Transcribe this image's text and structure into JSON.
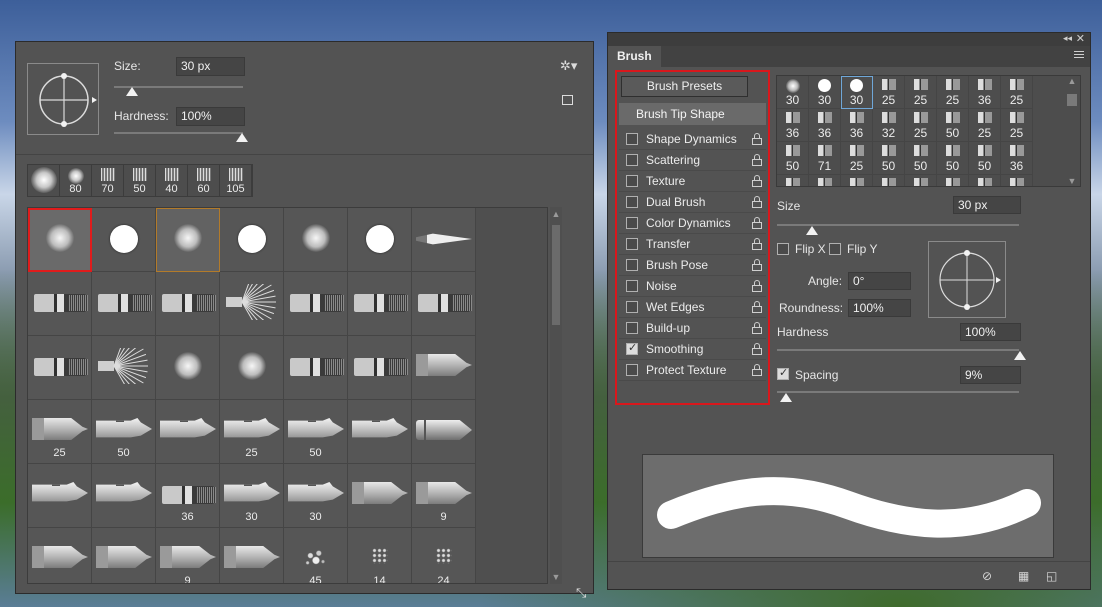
{
  "left_panel": {
    "size_label": "Size:",
    "size_value": "30 px",
    "hardness_label": "Hardness:",
    "hardness_value": "100%",
    "size_slider_fraction": 0.0,
    "hardness_slider_fraction": 1.0,
    "settings_icon": "gear-icon",
    "new_preset_icon": "new-preset-icon",
    "recent_brushes": [
      {
        "type": "soft-large",
        "label": ""
      },
      {
        "type": "soft",
        "label": "80"
      },
      {
        "type": "bristle",
        "label": "70"
      },
      {
        "type": "bristle",
        "label": "50"
      },
      {
        "type": "bristle",
        "label": "40"
      },
      {
        "type": "bristle",
        "label": "60"
      },
      {
        "type": "bristle",
        "label": "105"
      }
    ],
    "grid": [
      {
        "type": "soft",
        "label": "",
        "state": "red"
      },
      {
        "type": "hard",
        "label": ""
      },
      {
        "type": "soft",
        "label": "",
        "state": "orange"
      },
      {
        "type": "hard",
        "label": ""
      },
      {
        "type": "soft",
        "label": ""
      },
      {
        "type": "hard",
        "label": ""
      },
      {
        "type": "feather",
        "label": ""
      },
      {
        "type": "flat",
        "label": ""
      },
      {
        "type": "flat",
        "label": ""
      },
      {
        "type": "flat",
        "label": ""
      },
      {
        "type": "fan",
        "label": ""
      },
      {
        "type": "flat",
        "label": ""
      },
      {
        "type": "flat",
        "label": ""
      },
      {
        "type": "flat",
        "label": ""
      },
      {
        "type": "flat",
        "label": ""
      },
      {
        "type": "fan",
        "label": ""
      },
      {
        "type": "soft",
        "label": ""
      },
      {
        "type": "soft",
        "label": ""
      },
      {
        "type": "flat",
        "label": ""
      },
      {
        "type": "flat",
        "label": ""
      },
      {
        "type": "pencil",
        "label": ""
      },
      {
        "type": "pencil",
        "label": "25"
      },
      {
        "type": "calli",
        "label": "50"
      },
      {
        "type": "calli",
        "label": ""
      },
      {
        "type": "calli",
        "label": "25"
      },
      {
        "type": "calli",
        "label": "50"
      },
      {
        "type": "calli",
        "label": ""
      },
      {
        "type": "pen",
        "label": ""
      },
      {
        "type": "calli",
        "label": ""
      },
      {
        "type": "calli",
        "label": ""
      },
      {
        "type": "flat",
        "label": "36"
      },
      {
        "type": "calli",
        "label": "30"
      },
      {
        "type": "calli",
        "label": "30"
      },
      {
        "type": "pencil",
        "label": ""
      },
      {
        "type": "pencil",
        "label": "9"
      },
      {
        "type": "pencil",
        "label": ""
      },
      {
        "type": "pencil",
        "label": ""
      },
      {
        "type": "pencil",
        "label": "9"
      },
      {
        "type": "pencil",
        "label": ""
      },
      {
        "type": "spray",
        "label": "45"
      },
      {
        "type": "speck",
        "label": "14"
      },
      {
        "type": "speck",
        "label": "24"
      }
    ]
  },
  "brush_panel": {
    "tab_label": "Brush",
    "collapse_glyph": "◂◂",
    "close_glyph": "✕",
    "presets_button": "Brush Presets",
    "tip_shape_label": "Brush Tip Shape",
    "options": [
      {
        "label": "Shape Dynamics",
        "checked": false
      },
      {
        "label": "Scattering",
        "checked": false
      },
      {
        "label": "Texture",
        "checked": false
      },
      {
        "label": "Dual Brush",
        "checked": false
      },
      {
        "label": "Color Dynamics",
        "checked": false
      },
      {
        "label": "Transfer",
        "checked": false
      },
      {
        "label": "Brush Pose",
        "checked": false
      },
      {
        "label": "Noise",
        "checked": false
      },
      {
        "label": "Wet Edges",
        "checked": false
      },
      {
        "label": "Build-up",
        "checked": false
      },
      {
        "label": "Smoothing",
        "checked": true
      },
      {
        "label": "Protect Texture",
        "checked": false
      }
    ],
    "tips": [
      {
        "icon": "soft",
        "label": "30"
      },
      {
        "icon": "hard",
        "label": "30"
      },
      {
        "icon": "hard",
        "label": "30",
        "selected": true
      },
      {
        "icon": "brush",
        "label": "25"
      },
      {
        "icon": "brush",
        "label": "25"
      },
      {
        "icon": "brush",
        "label": "25"
      },
      {
        "icon": "brush",
        "label": "36"
      },
      {
        "icon": "brush",
        "label": "25"
      },
      {
        "icon": "brush",
        "label": "36"
      },
      {
        "icon": "brush",
        "label": "36"
      },
      {
        "icon": "brush",
        "label": "36"
      },
      {
        "icon": "brush",
        "label": "32"
      },
      {
        "icon": "brush",
        "label": "25"
      },
      {
        "icon": "brush",
        "label": "50"
      },
      {
        "icon": "brush",
        "label": "25"
      },
      {
        "icon": "brush",
        "label": "25"
      },
      {
        "icon": "brush",
        "label": "50"
      },
      {
        "icon": "brush",
        "label": "71"
      },
      {
        "icon": "brush",
        "label": "25"
      },
      {
        "icon": "brush",
        "label": "50"
      },
      {
        "icon": "brush",
        "label": "50"
      },
      {
        "icon": "brush",
        "label": "50"
      },
      {
        "icon": "brush",
        "label": "50"
      },
      {
        "icon": "brush",
        "label": "36"
      },
      {
        "icon": "brush",
        "label": ""
      },
      {
        "icon": "brush",
        "label": ""
      },
      {
        "icon": "brush",
        "label": ""
      },
      {
        "icon": "brush",
        "label": ""
      },
      {
        "icon": "brush",
        "label": ""
      },
      {
        "icon": "brush",
        "label": ""
      },
      {
        "icon": "brush",
        "label": ""
      },
      {
        "icon": "brush",
        "label": ""
      }
    ],
    "size_label": "Size",
    "size_value": "30 px",
    "flip_x_label": "Flip X",
    "flip_y_label": "Flip Y",
    "angle_label": "Angle:",
    "angle_value": "0°",
    "roundness_label": "Roundness:",
    "roundness_value": "100%",
    "hardness_label": "Hardness",
    "hardness_value": "100%",
    "spacing_label": "Spacing",
    "spacing_checked": true,
    "spacing_value": "9%",
    "size_slider_fraction": 0.0,
    "hardness_slider_fraction": 1.0,
    "spacing_slider_fraction": 0.0,
    "bottom_icons": [
      "toggle-preview-icon",
      "grid-icon",
      "new-preset-icon"
    ]
  },
  "colors": {
    "panel_bg": "#535353",
    "highlight_red": "#d9171c",
    "selected_orange": "#b37b2a",
    "selected_blue": "#6fa7d8"
  }
}
